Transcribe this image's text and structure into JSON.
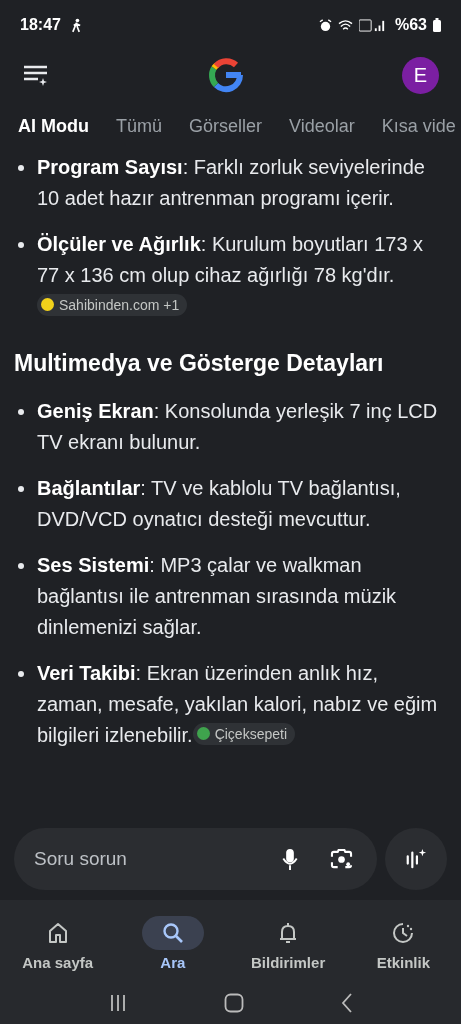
{
  "status_bar": {
    "time": "18:47",
    "battery": "%63"
  },
  "header": {
    "avatar": "E"
  },
  "tabs": [
    {
      "label": "AI Modu",
      "selected": true
    },
    {
      "label": "Tümü",
      "selected": false
    },
    {
      "label": "Görseller",
      "selected": false
    },
    {
      "label": "Videolar",
      "selected": false
    },
    {
      "label": "Kısa vide",
      "selected": false
    }
  ],
  "sections": [
    {
      "items": [
        {
          "text": "**Program Sayısı**: Farklı zorluk seviyelerinde 10 adet hazır antrenman programı içerir."
        },
        {
          "text": "**Ölçüler ve Ağırlık**: Kurulum boyutları 173 x 77 x 136 cm olup cihaz ağırlığı 78 kg'dır.",
          "source": {
            "label": "Sahibinden.com +1",
            "color": "#f2d21b"
          }
        }
      ]
    },
    {
      "heading": "Multimedya ve Gösterge Detayları",
      "items": [
        {
          "text": "**Geniş Ekran**: Konsolunda yerleşik 7 inç LCD TV ekranı bulunur."
        },
        {
          "text": "**Bağlantılar**: TV ve kablolu TV bağlantısı, DVD/VCD oynatıcı desteği mevcuttur."
        },
        {
          "text": "**Ses Sistemi**: MP3 çalar ve walkman bağlantısı ile antrenman sırasında müzik dinlemenizi sağlar."
        },
        {
          "text": "**Veri Takibi**: Ekran üzerinden anlık hız, zaman, mesafe, yakılan kalori, nabız ve eğim bilgileri izlenebilir.",
          "source": {
            "label": "Çiçeksepeti",
            "color": "#3fa34d"
          }
        }
      ]
    }
  ],
  "search": {
    "placeholder": "Soru sorun"
  },
  "bottom_nav": [
    {
      "label": "Ana sayfa",
      "kind": "home",
      "selected": false
    },
    {
      "label": "Ara",
      "kind": "search",
      "selected": true
    },
    {
      "label": "Bildirimler",
      "kind": "bell",
      "selected": false
    },
    {
      "label": "Etkinlik",
      "kind": "activity",
      "selected": false
    }
  ]
}
